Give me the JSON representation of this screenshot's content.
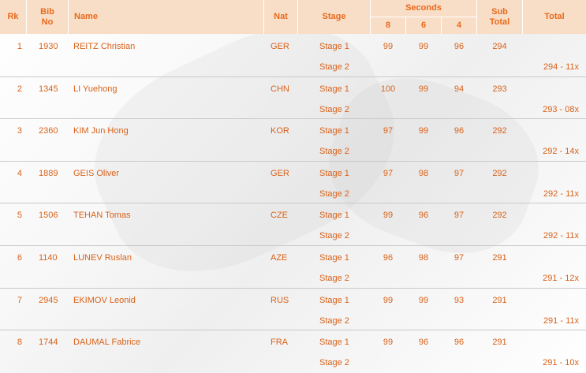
{
  "header": {
    "rk": "Rk",
    "bib": "Bib\nNo",
    "name": "Name",
    "nat": "Nat",
    "stage": "Stage",
    "seconds": "Seconds",
    "s8": "8",
    "s6": "6",
    "s4": "4",
    "subtotal": "Sub\nTotal",
    "total": "Total"
  },
  "rows": [
    {
      "rk": "1",
      "bib": "1930",
      "name": "REITZ Christian",
      "nat": "GER",
      "stage1": "Stage 1",
      "stage2": "Stage 2",
      "s8": "99",
      "s6": "99",
      "s4": "96",
      "sub": "294",
      "total": "294 - 11x"
    },
    {
      "rk": "2",
      "bib": "1345",
      "name": "LI Yuehong",
      "nat": "CHN",
      "stage1": "Stage 1",
      "stage2": "Stage 2",
      "s8": "100",
      "s6": "99",
      "s4": "94",
      "sub": "293",
      "total": "293 - 08x"
    },
    {
      "rk": "3",
      "bib": "2360",
      "name": "KIM Jun Hong",
      "nat": "KOR",
      "stage1": "Stage 1",
      "stage2": "Stage 2",
      "s8": "97",
      "s6": "99",
      "s4": "96",
      "sub": "292",
      "total": "292 - 14x"
    },
    {
      "rk": "4",
      "bib": "1889",
      "name": "GEIS Oliver",
      "nat": "GER",
      "stage1": "Stage 1",
      "stage2": "Stage 2",
      "s8": "97",
      "s6": "98",
      "s4": "97",
      "sub": "292",
      "total": "292 - 11x"
    },
    {
      "rk": "5",
      "bib": "1506",
      "name": "TEHAN Tomas",
      "nat": "CZE",
      "stage1": "Stage 1",
      "stage2": "Stage 2",
      "s8": "99",
      "s6": "96",
      "s4": "97",
      "sub": "292",
      "total": "292 - 11x"
    },
    {
      "rk": "6",
      "bib": "1140",
      "name": "LUNEV Ruslan",
      "nat": "AZE",
      "stage1": "Stage 1",
      "stage2": "Stage 2",
      "s8": "96",
      "s6": "98",
      "s4": "97",
      "sub": "291",
      "total": "291 - 12x"
    },
    {
      "rk": "7",
      "bib": "2945",
      "name": "EKIMOV Leonid",
      "nat": "RUS",
      "stage1": "Stage 1",
      "stage2": "Stage 2",
      "s8": "99",
      "s6": "99",
      "s4": "93",
      "sub": "291",
      "total": "291 - 11x"
    },
    {
      "rk": "8",
      "bib": "1744",
      "name": "DAUMAL Fabrice",
      "nat": "FRA",
      "stage1": "Stage 1",
      "stage2": "Stage 2",
      "s8": "99",
      "s6": "96",
      "s4": "96",
      "sub": "291",
      "total": "291 - 10x"
    }
  ]
}
